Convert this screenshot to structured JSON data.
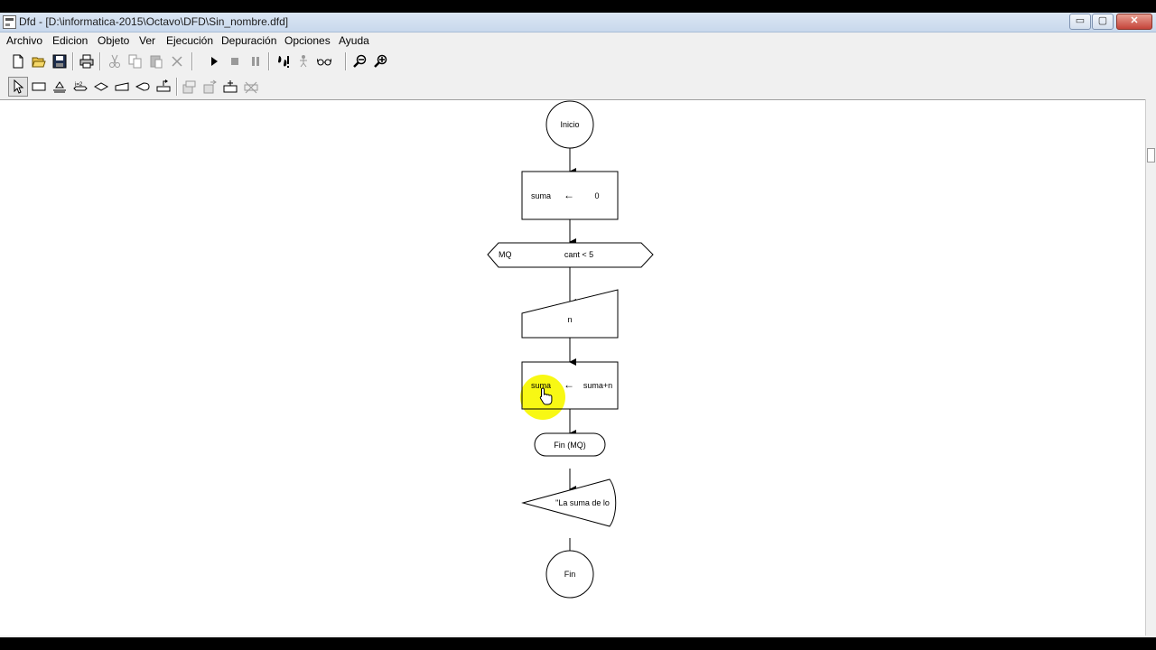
{
  "window": {
    "title": "Dfd - [D:\\informatica-2015\\Octavo\\DFD\\Sin_nombre.dfd]",
    "controls": {
      "minimize": "▭",
      "maximize": "▢",
      "close": "✕"
    }
  },
  "menu": {
    "items": [
      "Archivo",
      "Edicion",
      "Objeto",
      "Ver",
      "Ejecución",
      "Depuración",
      "Opciones",
      "Ayuda"
    ]
  },
  "toolbar1": {
    "buttons": [
      "new-file-icon",
      "open-folder-icon",
      "save-disk-icon",
      "print-icon",
      "cut-icon",
      "copy-icon",
      "paste-icon",
      "delete-icon",
      "run-play-icon",
      "stop-icon",
      "pause-icon",
      "step-debug-icon",
      "step-into-icon",
      "watch-glasses-icon",
      "zoom-out-icon",
      "zoom-in-icon"
    ]
  },
  "toolbar2": {
    "buttons": [
      "cursor-arrow-icon",
      "assignment-shape-icon",
      "cycle-shape-icon",
      "for-loop-shape-icon",
      "decision-shape-icon",
      "read-shape-icon",
      "write-shape-icon",
      "subprogram-shape-icon",
      "remove-subprogram-icon",
      "previous-subprogram-icon",
      "next-subprogram-icon",
      "delete-subprogram-icon"
    ]
  },
  "flowchart": {
    "start": "Inicio",
    "assign1": {
      "variable": "suma",
      "arrow": "←",
      "value": "0"
    },
    "loop": {
      "keyword": "MQ",
      "condition": "cant < 5"
    },
    "read": {
      "variable": "n"
    },
    "assign2": {
      "variable": "suma",
      "arrow": "←",
      "value": "suma+n"
    },
    "loop_end": "Fin (MQ)",
    "write": {
      "text": "\"La suma de lo"
    },
    "end": "Fin"
  },
  "colors": {
    "cursor_highlight": "#f7f700",
    "title_bar": "#d6e2f1",
    "close_button": "#c5443a"
  }
}
